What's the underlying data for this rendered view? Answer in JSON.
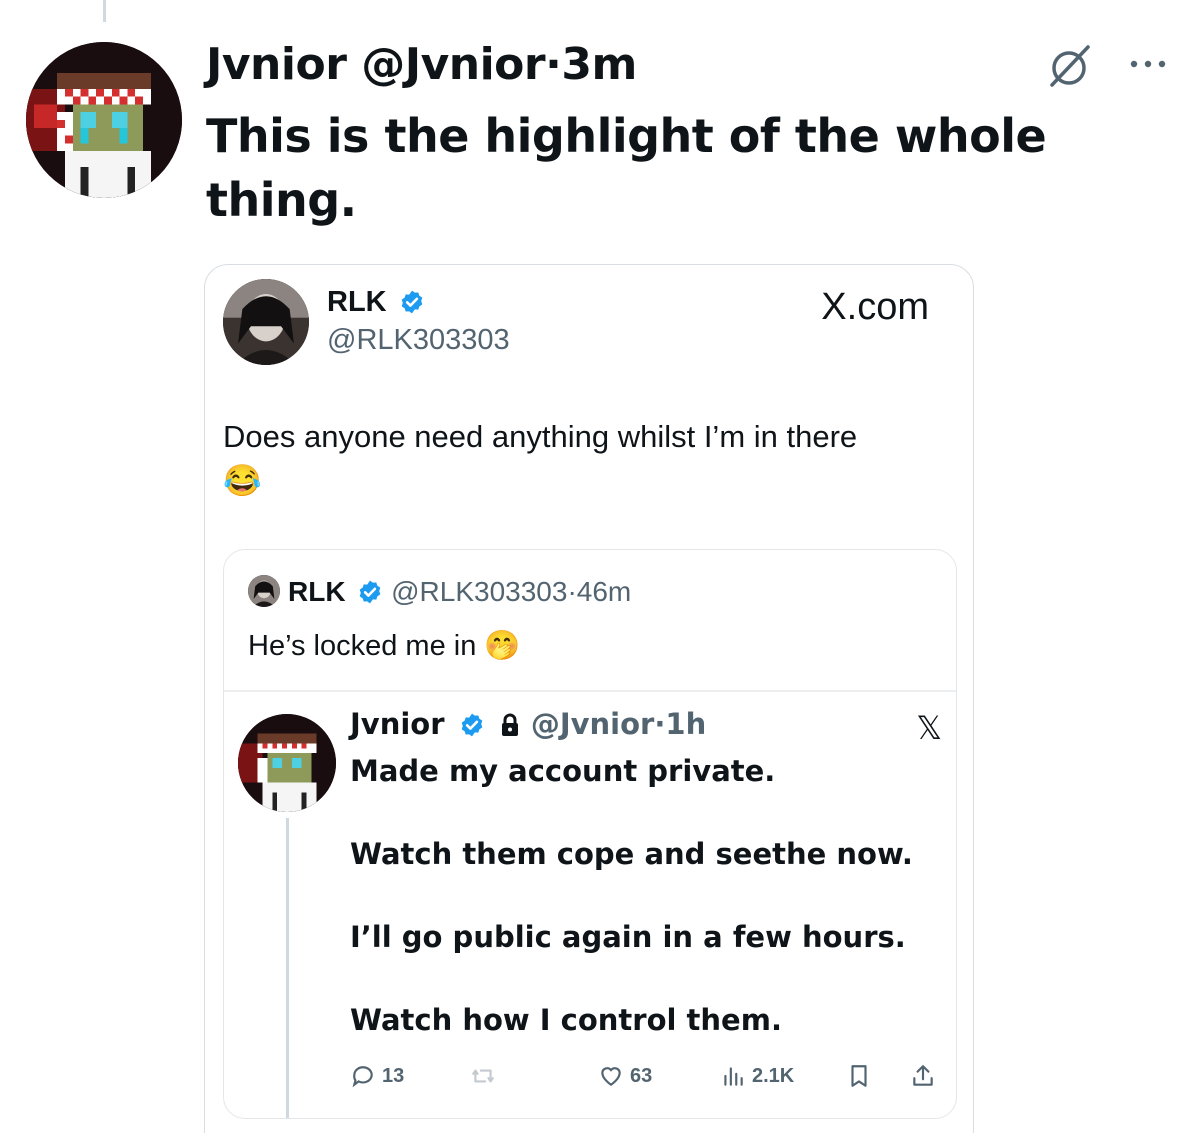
{
  "post": {
    "author_name": "Jvnior",
    "author_handle": "@Jvnior",
    "separator": "·",
    "time": "3m",
    "text": "This is the highlight of the whole thing.",
    "icons": [
      "grok-icon",
      "more-icon"
    ]
  },
  "embed": {
    "author_name": "RLK",
    "author_handle": "@RLK303303",
    "site": "X.com",
    "text": "Does anyone need anything whilst I’m in there",
    "emoji": "😂",
    "quote": {
      "author_name": "RLK",
      "author_handle": "@RLK303303",
      "separator": "·",
      "time": "46m",
      "text": "He’s locked me in",
      "emoji": "🤭",
      "inner": {
        "author_name": "Jvnior",
        "author_handle": "@Jvnior",
        "separator": "·",
        "time": "1h",
        "x_mark": "𝕏",
        "lines": [
          "Made my account private.",
          "Watch them cope and seethe now.",
          "I’ll go public again in a few hours.",
          "Watch how I control them."
        ],
        "stats": {
          "replies": "13",
          "reposts": "",
          "likes": "63",
          "views": "2.1K"
        }
      }
    }
  },
  "colors": {
    "verified": "#1d9bf0",
    "text": "#0f1419",
    "muted": "#536471",
    "border": "#d9dde1"
  }
}
